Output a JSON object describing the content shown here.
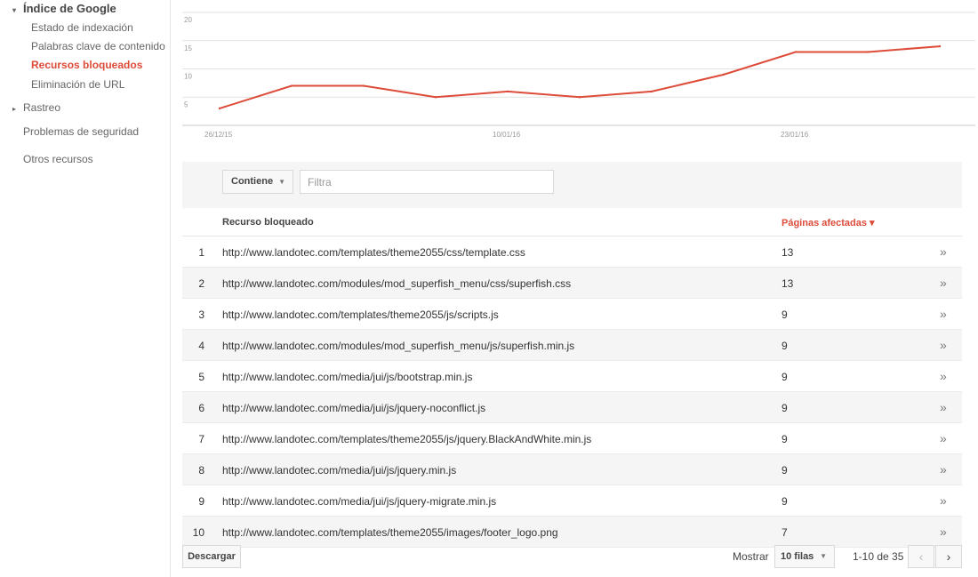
{
  "sidebar": {
    "section_title": "Índice de Google",
    "sub_items": [
      {
        "label": "Estado de indexación"
      },
      {
        "label": "Palabras clave de contenido"
      },
      {
        "label": "Recursos bloqueados",
        "active": true
      },
      {
        "label": "Eliminación de URL"
      }
    ],
    "rastreo": "Rastreo",
    "security": "Problemas de seguridad",
    "other": "Otros recursos"
  },
  "chart_data": {
    "type": "line",
    "x": [
      "26/12/15",
      "30/12/15",
      "03/01/16",
      "07/01/16",
      "10/01/16",
      "13/01/16",
      "17/01/16",
      "20/01/16",
      "23/01/16",
      "26/01/16",
      "29/01/16"
    ],
    "x_tick_labels": [
      "26/12/15",
      "10/01/16",
      "23/01/16"
    ],
    "series": [
      {
        "values": [
          3,
          7,
          7,
          5,
          6,
          5,
          6,
          9,
          13,
          13,
          14
        ]
      }
    ],
    "ylim": [
      0,
      20
    ],
    "y_ticks": [
      5,
      10,
      15,
      20
    ],
    "grid": true,
    "line_color": "#dd4b39"
  },
  "filter": {
    "select_label": "Contiene",
    "input_placeholder": "Filtra"
  },
  "table": {
    "col_resource": "Recurso bloqueado",
    "col_pages": "Páginas afectadas ▾",
    "rows": [
      {
        "num": "1",
        "url": "http://www.landotec.com/templates/theme2055/css/template.css",
        "pages": "13"
      },
      {
        "num": "2",
        "url": "http://www.landotec.com/modules/mod_superfish_menu/css/superfish.css",
        "pages": "13"
      },
      {
        "num": "3",
        "url": "http://www.landotec.com/templates/theme2055/js/scripts.js",
        "pages": "9"
      },
      {
        "num": "4",
        "url": "http://www.landotec.com/modules/mod_superfish_menu/js/superfish.min.js",
        "pages": "9"
      },
      {
        "num": "5",
        "url": "http://www.landotec.com/media/jui/js/bootstrap.min.js",
        "pages": "9"
      },
      {
        "num": "6",
        "url": "http://www.landotec.com/media/jui/js/jquery-noconflict.js",
        "pages": "9"
      },
      {
        "num": "7",
        "url": "http://www.landotec.com/templates/theme2055/js/jquery.BlackAndWhite.min.js",
        "pages": "9"
      },
      {
        "num": "8",
        "url": "http://www.landotec.com/media/jui/js/jquery.min.js",
        "pages": "9"
      },
      {
        "num": "9",
        "url": "http://www.landotec.com/media/jui/js/jquery-migrate.min.js",
        "pages": "9"
      },
      {
        "num": "10",
        "url": "http://www.landotec.com/templates/theme2055/images/footer_logo.png",
        "pages": "7"
      }
    ]
  },
  "footer": {
    "download": "Descargar",
    "show": "Mostrar",
    "rows_select": "10 filas",
    "page_info": "1-10 de 35",
    "prev": "‹",
    "next": "›"
  },
  "icons": {
    "expand": "▾",
    "collapsed": "▸",
    "caret": "▼",
    "row_chevron": "»"
  }
}
